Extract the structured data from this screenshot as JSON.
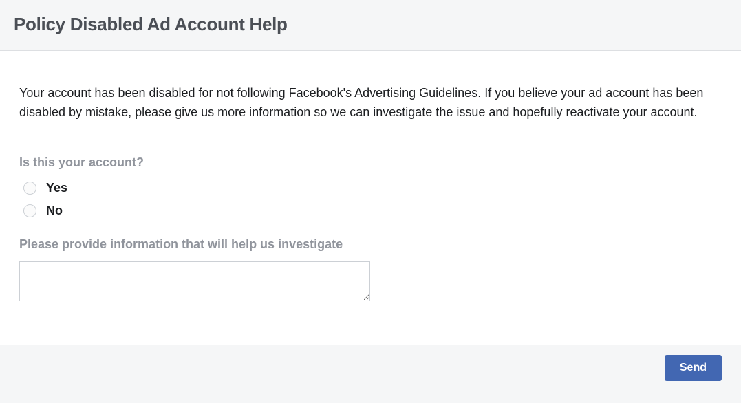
{
  "header": {
    "title": "Policy Disabled Ad Account Help"
  },
  "content": {
    "description": "Your account has been disabled for not following Facebook's Advertising Guidelines. If you believe your ad account has been disabled by mistake, please give us more information so we can investigate the issue and hopefully reactivate your account.",
    "question1": {
      "label": "Is this your account?",
      "options": {
        "yes": "Yes",
        "no": "No"
      }
    },
    "question2": {
      "label": "Please provide information that will help us investigate",
      "value": ""
    }
  },
  "footer": {
    "send_label": "Send"
  }
}
